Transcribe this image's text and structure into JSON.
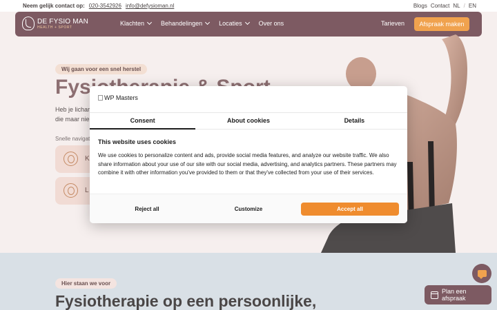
{
  "topbar": {
    "contact_label": "Neem gelijk contact op:",
    "phone": "020-3542926",
    "email": "info@defysioman.nl",
    "links": [
      "Blogs",
      "Contact"
    ],
    "lang_nl": "NL",
    "lang_sep": "/",
    "lang_en": "EN"
  },
  "nav": {
    "logo_prefix": "DE",
    "logo_name": " FYSIO MAN",
    "logo_sub": "HEALTH + SPORT",
    "menu": [
      {
        "label": "Klachten"
      },
      {
        "label": "Behandelingen"
      },
      {
        "label": "Locaties"
      },
      {
        "label": "Over ons"
      }
    ],
    "tarieven": "Tarieven",
    "cta": "Afspraak maken"
  },
  "hero": {
    "badge": "Wij gaan voor een snel herstel",
    "title": "Fysiotherapie & Sport",
    "text_line1": "Heb je lichar",
    "text_line2": "die maar nie",
    "quicknav_label": "Snelle navigat",
    "card1_label": "K",
    "card2_label": "L"
  },
  "section2": {
    "badge": "Hier staan we voor",
    "title": "Fysiotherapie op een persoonlijke,"
  },
  "floating": {
    "plan_label": "Plan een afspraak"
  },
  "cookie": {
    "logo_alt": "WP Masters",
    "tabs": [
      "Consent",
      "About cookies",
      "Details"
    ],
    "heading": "This website uses cookies",
    "body": "We use cookies to personalize content and ads, provide social media features, and analyze our website traffic. We also share information about your use of our site with our social media, advertising, and analytics partners. These partners may combine it with other information you've provided to them or that they've collected from your use of their services.",
    "reject": "Reject all",
    "customize": "Customize",
    "accept": "Accept all"
  },
  "colors": {
    "brand": "#7d5a62",
    "accent": "#f0a24e",
    "cookie_accept": "#ef8c2e"
  }
}
